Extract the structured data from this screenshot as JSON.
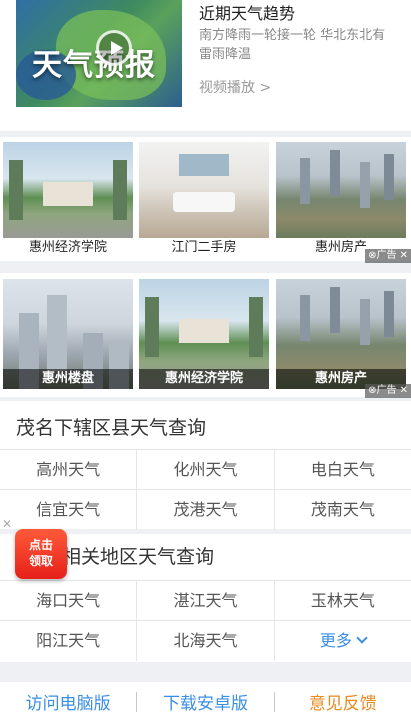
{
  "video": {
    "title": "近期天气趋势",
    "description": "南方降雨一轮接一轮 华北东北有雷雨降温",
    "thumb_logo": "天气预报",
    "link": "视频播放 >"
  },
  "ads": {
    "tag": "⊗广告 ✕",
    "row1": [
      {
        "caption": "惠州经济学院"
      },
      {
        "caption": "江门二手房"
      },
      {
        "caption": "惠州房产"
      }
    ],
    "row2": [
      {
        "caption": "惠州楼盘"
      },
      {
        "caption": "惠州经济学院"
      },
      {
        "caption": "惠州房产"
      }
    ]
  },
  "county_section": {
    "title": "茂名下辖区县天气查询",
    "rows": [
      [
        "高州天气",
        "化州天气",
        "电白天气"
      ],
      [
        "信宜天气",
        "茂港天气",
        "茂南天气"
      ]
    ]
  },
  "related_section": {
    "title": "相关地区天气查询",
    "rows": [
      [
        "海口天气",
        "湛江天气",
        "玉林天气"
      ],
      [
        "阳江天气",
        "北海天气"
      ]
    ],
    "more_label": "更多"
  },
  "promo": {
    "close": "✕",
    "line1": "点击",
    "line2": "领取"
  },
  "footer": {
    "desktop": "访问电脑版",
    "android": "下载安卓版",
    "feedback": "意见反馈"
  },
  "colors": {
    "link_blue": "#3a8ee6",
    "feedback_orange": "#e98a22",
    "promo_red": "#e6201a"
  }
}
